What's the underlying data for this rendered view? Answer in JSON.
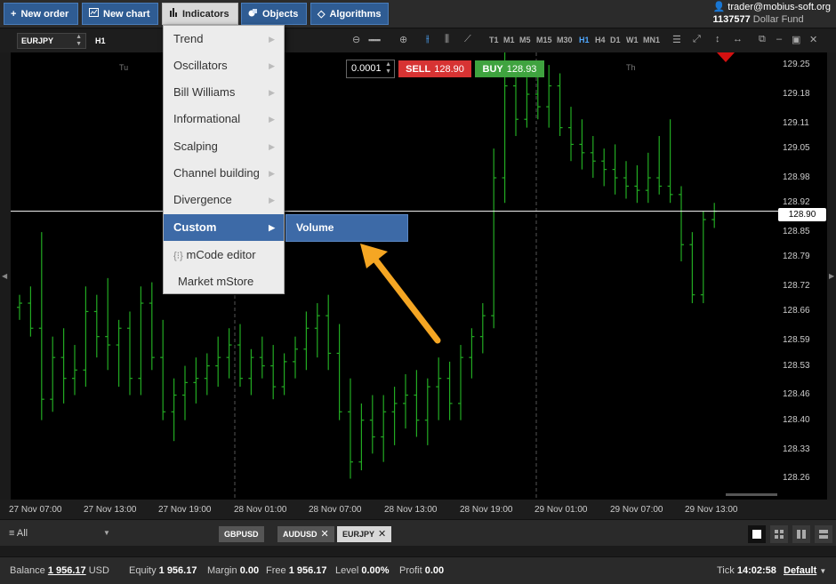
{
  "toolbar": {
    "new_order": "New order",
    "new_chart": "New chart",
    "indicators": "Indicators",
    "objects": "Objects",
    "algorithms": "Algorithms"
  },
  "account": {
    "user": "trader@mobius-soft.org",
    "number": "1137577",
    "fund": "Dollar Fund"
  },
  "chart_tools": {
    "symbol": "EURJPY",
    "timeframe": "H1",
    "timeframes": [
      "T1",
      "M1",
      "M5",
      "M15",
      "M30",
      "H1",
      "H4",
      "D1",
      "W1",
      "MN1"
    ],
    "active_timeframe": "H1"
  },
  "trade": {
    "lot": "0.0001",
    "sell_label": "SELL",
    "sell_price": "128.90",
    "buy_label": "BUY",
    "buy_price": "128.93"
  },
  "menu": {
    "items": [
      {
        "label": "Trend"
      },
      {
        "label": "Oscillators"
      },
      {
        "label": "Bill Williams"
      },
      {
        "label": "Informational"
      },
      {
        "label": "Scalping"
      },
      {
        "label": "Channel building"
      },
      {
        "label": "Divergence"
      },
      {
        "label": "Custom"
      }
    ],
    "mcode": "mCode editor",
    "mstore": "Market mStore",
    "submenu": "Volume"
  },
  "chart": {
    "current_price": "128.90",
    "y_ticks": [
      "129.25",
      "129.18",
      "129.11",
      "129.05",
      "128.98",
      "128.92",
      "128.85",
      "128.79",
      "128.72",
      "128.66",
      "128.59",
      "128.53",
      "128.46",
      "128.40",
      "128.33",
      "128.26"
    ],
    "x_ticks": [
      "27 Nov 07:00",
      "27 Nov 13:00",
      "27 Nov 19:00",
      "28 Nov 01:00",
      "28 Nov 07:00",
      "28 Nov 13:00",
      "28 Nov 19:00",
      "29 Nov 01:00",
      "29 Nov 07:00",
      "29 Nov 13:00"
    ],
    "day_labels": [
      "Tu",
      "Th"
    ],
    "colors": {
      "bars": "#22aa22",
      "background": "#000000",
      "price_line": "#ffffff",
      "arrow": "#f5a623"
    }
  },
  "chart_data": {
    "type": "ohlc",
    "symbol": "EURJPY",
    "timeframe": "H1",
    "x": [
      "27 Nov 07:00",
      "27 Nov 13:00",
      "27 Nov 19:00",
      "28 Nov 01:00",
      "28 Nov 07:00",
      "28 Nov 13:00",
      "28 Nov 19:00",
      "29 Nov 01:00",
      "29 Nov 07:00",
      "29 Nov 13:00"
    ],
    "ylim": [
      128.21,
      129.28
    ],
    "last_price": 128.9,
    "series": [
      {
        "values": [
          [
            128.67,
            128.7,
            128.64,
            128.68
          ],
          [
            128.68,
            128.72,
            128.6,
            128.62
          ],
          [
            128.62,
            128.85,
            128.4,
            128.45
          ],
          [
            128.45,
            128.6,
            128.42,
            128.55
          ],
          [
            128.55,
            128.62,
            128.44,
            128.5
          ],
          [
            128.5,
            128.58,
            128.46,
            128.52
          ],
          [
            128.52,
            128.72,
            128.48,
            128.66
          ],
          [
            128.66,
            128.7,
            128.55,
            128.6
          ],
          [
            128.6,
            128.74,
            128.52,
            128.58
          ],
          [
            128.58,
            128.64,
            128.48,
            128.62
          ],
          [
            128.62,
            128.66,
            128.46,
            128.5
          ],
          [
            128.5,
            128.72,
            128.46,
            128.68
          ],
          [
            128.68,
            128.73,
            128.52,
            128.55
          ],
          [
            128.55,
            128.64,
            128.4,
            128.42
          ],
          [
            128.42,
            128.5,
            128.35,
            128.46
          ],
          [
            128.46,
            128.53,
            128.4,
            128.49
          ],
          [
            128.49,
            128.55,
            128.44,
            128.5
          ],
          [
            128.5,
            128.56,
            128.46,
            128.53
          ],
          [
            128.53,
            128.6,
            128.48,
            128.55
          ],
          [
            128.55,
            128.62,
            128.5,
            128.58
          ],
          [
            128.58,
            128.63,
            128.48,
            128.5
          ],
          [
            128.5,
            128.57,
            128.46,
            128.55
          ],
          [
            128.55,
            128.6,
            128.5,
            128.53
          ],
          [
            128.53,
            128.58,
            128.45,
            128.48
          ],
          [
            128.48,
            128.56,
            128.46,
            128.54
          ],
          [
            128.54,
            128.6,
            128.5,
            128.57
          ],
          [
            128.57,
            128.66,
            128.52,
            128.62
          ],
          [
            128.62,
            128.68,
            128.55,
            128.65
          ],
          [
            128.65,
            128.7,
            128.52,
            128.56
          ],
          [
            128.56,
            128.63,
            128.4,
            128.42
          ],
          [
            128.42,
            128.5,
            128.26,
            128.3
          ],
          [
            128.3,
            128.44,
            128.28,
            128.4
          ],
          [
            128.4,
            128.46,
            128.32,
            128.36
          ],
          [
            128.36,
            128.46,
            128.3,
            128.42
          ],
          [
            128.42,
            128.48,
            128.34,
            128.44
          ],
          [
            128.44,
            128.51,
            128.38,
            128.46
          ],
          [
            128.46,
            128.52,
            128.36,
            128.4
          ],
          [
            128.4,
            128.5,
            128.34,
            128.48
          ],
          [
            128.48,
            128.55,
            128.4,
            128.5
          ],
          [
            128.5,
            128.54,
            128.4,
            128.44
          ],
          [
            128.44,
            128.58,
            128.4,
            128.55
          ],
          [
            128.55,
            128.62,
            128.5,
            128.6
          ],
          [
            128.6,
            128.68,
            128.56,
            128.65
          ],
          [
            128.65,
            129.05,
            128.62,
            128.98
          ],
          [
            128.98,
            129.28,
            128.92,
            129.2
          ],
          [
            129.2,
            129.25,
            129.08,
            129.12
          ],
          [
            129.12,
            129.22,
            129.1,
            129.18
          ],
          [
            129.18,
            129.24,
            129.12,
            129.15
          ],
          [
            129.15,
            129.25,
            129.1,
            129.2
          ],
          [
            129.2,
            129.23,
            129.08,
            129.1
          ],
          [
            129.1,
            129.15,
            129.02,
            129.06
          ],
          [
            129.06,
            129.12,
            129.0,
            129.04
          ],
          [
            129.04,
            129.08,
            128.98,
            129.02
          ],
          [
            129.02,
            129.05,
            128.96,
            129.0
          ],
          [
            129.0,
            129.06,
            128.94,
            128.98
          ],
          [
            128.98,
            129.02,
            128.93,
            128.96
          ],
          [
            128.96,
            129.01,
            128.92,
            128.95
          ],
          [
            128.95,
            129.04,
            128.92,
            128.98
          ],
          [
            128.98,
            129.08,
            128.94,
            128.96
          ],
          [
            128.96,
            129.12,
            128.92,
            128.94
          ],
          [
            128.94,
            128.96,
            128.78,
            128.82
          ],
          [
            128.82,
            128.85,
            128.68,
            128.7
          ],
          [
            128.7,
            128.9,
            128.68,
            128.88
          ],
          [
            128.88,
            128.92,
            128.86,
            128.9
          ]
        ]
      }
    ]
  },
  "tabs": {
    "filter": "All",
    "symbols": [
      "GBPUSD",
      "AUDUSD",
      "EURJPY"
    ],
    "active": "EURJPY"
  },
  "status": {
    "balance_label": "Balance",
    "balance": "1 956.17",
    "currency": "USD",
    "equity_label": "Equity",
    "equity": "1 956.17",
    "margin_label": "Margin",
    "margin": "0.00",
    "free_label": "Free",
    "free": "1 956.17",
    "level_label": "Level",
    "level": "0.00%",
    "profit_label": "Profit",
    "profit": "0.00",
    "tick_label": "Tick",
    "tick": "14:02:58",
    "profile": "Default"
  }
}
